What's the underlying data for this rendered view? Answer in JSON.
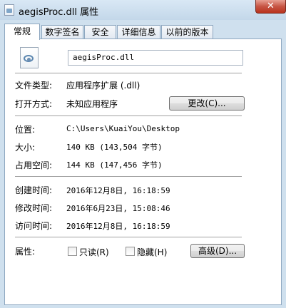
{
  "window": {
    "title": "aegisProc.dll 属性",
    "close_glyph": "✕"
  },
  "tabs": [
    {
      "label": "常规",
      "active": true
    },
    {
      "label": "数字签名",
      "active": false
    },
    {
      "label": "安全",
      "active": false
    },
    {
      "label": "详细信息",
      "active": false
    },
    {
      "label": "以前的版本",
      "active": false
    }
  ],
  "general": {
    "file_icon": "dll-file-icon",
    "file_name": "aegisProc.dll",
    "type_label": "文件类型:",
    "type_value": "应用程序扩展 (.dll)",
    "opens_with_label": "打开方式:",
    "opens_with_value": "未知应用程序",
    "change_button": "更改(C)...",
    "location_label": "位置:",
    "location_value": "C:\\Users\\KuaiYou\\Desktop",
    "size_label": "大小:",
    "size_value": "140 KB (143,504 字节)",
    "size_on_disk_label": "占用空间:",
    "size_on_disk_value": "144 KB (147,456 字节)",
    "created_label": "创建时间:",
    "created_value": "2016年12月8日, 16:18:59",
    "modified_label": "修改时间:",
    "modified_value": "2016年6月23日, 15:08:46",
    "accessed_label": "访问时间:",
    "accessed_value": "2016年12月8日, 16:18:59",
    "attributes_label": "属性:",
    "readonly_label": "只读(R)",
    "readonly_checked": false,
    "hidden_label": "隐藏(H)",
    "hidden_checked": false,
    "advanced_button": "高级(D)..."
  }
}
